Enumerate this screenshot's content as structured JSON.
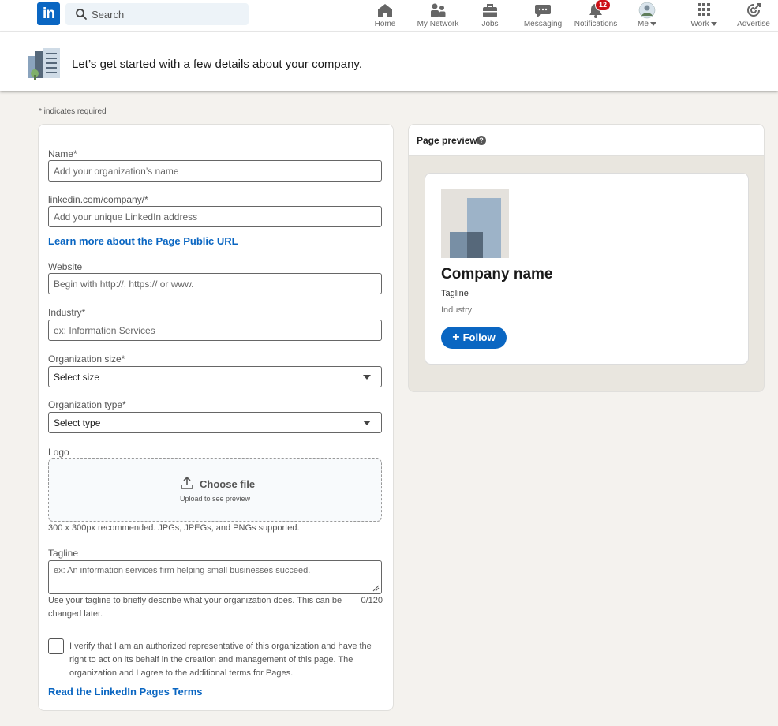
{
  "nav": {
    "logo_text": "in",
    "search_placeholder": "Search",
    "items": [
      {
        "label": "Home",
        "icon": "home-icon"
      },
      {
        "label": "My Network",
        "icon": "network-icon"
      },
      {
        "label": "Jobs",
        "icon": "briefcase-icon"
      },
      {
        "label": "Messaging",
        "icon": "message-icon"
      },
      {
        "label": "Notifications",
        "icon": "bell-icon",
        "badge": "12"
      },
      {
        "label": "Me",
        "icon": "avatar"
      },
      {
        "label": "Work",
        "icon": "grid-icon"
      },
      {
        "label": "Advertise",
        "icon": "advertise-icon"
      }
    ]
  },
  "banner": {
    "text": "Let’s get started with a few details about your company."
  },
  "form": {
    "required_note": "*  indicates required",
    "name_label": "Name*",
    "name_placeholder": "Add your organization’s name",
    "url_label": "linkedin.com/company/*",
    "url_placeholder": "Add your unique LinkedIn address",
    "url_link": "Learn more about the Page Public URL",
    "website_label": "Website",
    "website_placeholder": "Begin with http://, https:// or www.",
    "industry_label": "Industry*",
    "industry_placeholder": "ex: Information Services",
    "size_label": "Organization size*",
    "size_value": "Select size",
    "type_label": "Organization type*",
    "type_value": "Select type",
    "logo_label": "Logo",
    "choose_file": "Choose file",
    "upload_sub": "Upload to see preview",
    "logo_hint": "300 x 300px recommended. JPGs, JPEGs, and PNGs supported.",
    "tagline_label": "Tagline",
    "tagline_placeholder": "ex: An information services firm helping small businesses succeed.",
    "tagline_hint": "Use your tagline to briefly describe what your organization does. This can be changed later.",
    "tagline_counter": "0/120",
    "verify_text": "I verify that I am an authorized representative of this organization and have the right to act on its behalf in the creation and management of this page. The organization and I agree to the additional terms for Pages.",
    "terms_link": "Read the LinkedIn Pages Terms"
  },
  "preview": {
    "title": "Page preview",
    "company_name": "Company name",
    "tagline": "Tagline",
    "industry": "Industry",
    "follow_label": "Follow"
  },
  "colors": {
    "brand": "#0a66c2",
    "page_bg": "#f4f2ee",
    "badge": "#cc1016"
  }
}
